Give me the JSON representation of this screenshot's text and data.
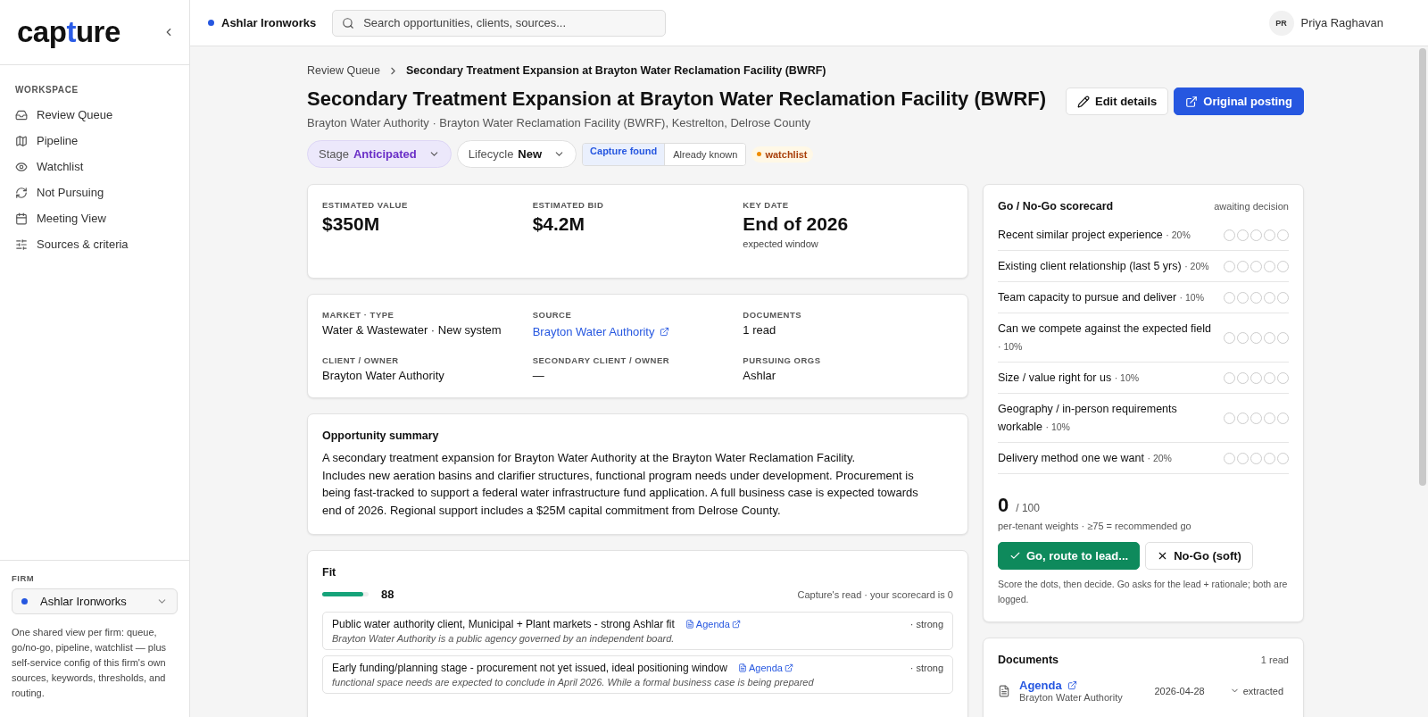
{
  "logo": [
    {
      "text": "cap",
      "accent": false
    },
    {
      "text": "t",
      "accent": true
    },
    {
      "text": "ure",
      "accent": false
    }
  ],
  "sidebar": {
    "section": "WORKSPACE",
    "items": [
      {
        "label": "Review Queue",
        "selected": false
      },
      {
        "label": "Pipeline",
        "selected": false
      },
      {
        "label": "Watchlist",
        "selected": false
      },
      {
        "label": "Not Pursuing",
        "selected": false
      },
      {
        "label": "Meeting View",
        "selected": false
      },
      {
        "label": "Sources & criteria",
        "selected": false
      }
    ],
    "firm_label": "FIRM",
    "firm": "Ashlar Ironworks",
    "firm_note": "One shared view per firm: queue, go/no-go, pipeline, watchlist — plus self-service config of this firm's own sources, keywords, thresholds, and routing."
  },
  "topbar": {
    "workspace": "Ashlar Ironworks",
    "search_placeholder": "Search opportunities, clients, sources...",
    "user_initials": "PR",
    "user_name": "Priya Raghavan"
  },
  "breadcrumb": [
    "Review Queue",
    "Secondary Treatment Expansion at Brayton Water Reclamation Facility (BWRF)"
  ],
  "title": "Secondary Treatment Expansion at Brayton Water Reclamation Facility (BWRF)",
  "subtitle": "Brayton Water Authority · Brayton Water Reclamation Facility (BWRF), Kestrelton, Delrose County",
  "actions": [
    {
      "label": "Edit details",
      "kind": "secondary"
    },
    {
      "label": "Original posting",
      "kind": "primary"
    }
  ],
  "stage": {
    "label": "Stage",
    "value": "Anticipated"
  },
  "lifecycle": {
    "label": "Lifecycle",
    "value": "New"
  },
  "origin": [
    {
      "label": "Capture found",
      "selected": true
    },
    {
      "label": "Already known",
      "selected": false
    }
  ],
  "tag": "watchlist",
  "metrics": [
    {
      "label": "ESTIMATED VALUE",
      "value": "$350M"
    },
    {
      "label": "ESTIMATED BID",
      "value": "$4.2M"
    },
    {
      "label": "KEY DATE",
      "value": "End of 2026",
      "note": "expected window"
    }
  ],
  "facts": [
    {
      "label": "MARKET · TYPE",
      "value": "Water & Wastewater · New system",
      "kind": "text"
    },
    {
      "label": "SOURCE",
      "value": "Brayton Water Authority",
      "kind": "link"
    },
    {
      "label": "DOCUMENTS",
      "value": "1 read",
      "kind": "text"
    },
    {
      "label": "CLIENT / OWNER",
      "value": "Brayton Water Authority",
      "kind": "text"
    },
    {
      "label": "SECONDARY CLIENT / OWNER",
      "value": "—",
      "kind": "text"
    },
    {
      "label": "PURSUING ORGS",
      "value": "Ashlar",
      "kind": "text"
    }
  ],
  "summary": {
    "title": "Opportunity summary",
    "paragraphs": [
      "A secondary treatment expansion for Brayton Water Authority at the Brayton Water Reclamation Facility.",
      "Includes new aeration basins and clarifier structures, functional program needs under development. Procurement is being fast-tracked to support a federal water infrastructure fund application. A full business case is expected towards end of 2026. Regional support includes a $25M capital commitment from Delrose County."
    ]
  },
  "fit": {
    "title": "Fit",
    "level": 0.88,
    "score": "88",
    "note": "Capture's read · your scorecard is 0",
    "rows": [
      {
        "text": "Public water authority client, Municipal + Plant markets - strong Ashlar fit",
        "link": "Agenda",
        "strength": "· strong",
        "quote": "Brayton Water Authority is a public agency governed by an independent board."
      },
      {
        "text": "Early funding/planning stage - procurement not yet issued, ideal positioning window",
        "link": "Agenda",
        "strength": "· strong",
        "quote": "functional space needs are expected to conclude in April 2026. While a formal business case is being prepared"
      }
    ]
  },
  "scorecard": {
    "title": "Go / No-Go scorecard",
    "status": "awaiting decision",
    "criteria": [
      {
        "label": "Recent similar project experience",
        "weight": "· 20%",
        "stars": 0
      },
      {
        "label": "Existing client relationship (last 5 yrs)",
        "weight": "· 20%",
        "stars": 0
      },
      {
        "label": "Team capacity to pursue and deliver",
        "weight": "· 10%",
        "stars": 0
      },
      {
        "label": "Can we compete against the expected field",
        "weight": "· 10%",
        "stars": 0
      },
      {
        "label": "Size / value right for us",
        "weight": "· 10%",
        "stars": 0
      },
      {
        "label": "Geography / in-person requirements workable",
        "weight": "· 10%",
        "stars": 0
      },
      {
        "label": "Delivery method one we want",
        "weight": "· 20%",
        "stars": 0
      }
    ],
    "total": "0",
    "out_of": "/ 100",
    "weights_note": "per-tenant weights · ≥75 = recommended go",
    "buttons": [
      {
        "label": "Go, route to lead...",
        "kind": "go"
      },
      {
        "label": "No-Go (soft)",
        "kind": "nogo"
      }
    ],
    "footnote": "Score the dots, then decide. Go asks for the lead + rationale; both are logged."
  },
  "documents": {
    "title": "Documents",
    "count": "1 read",
    "items": [
      {
        "name": "Agenda",
        "source": "Brayton Water Authority",
        "date": "2026-04-28",
        "status": "extracted"
      }
    ]
  }
}
